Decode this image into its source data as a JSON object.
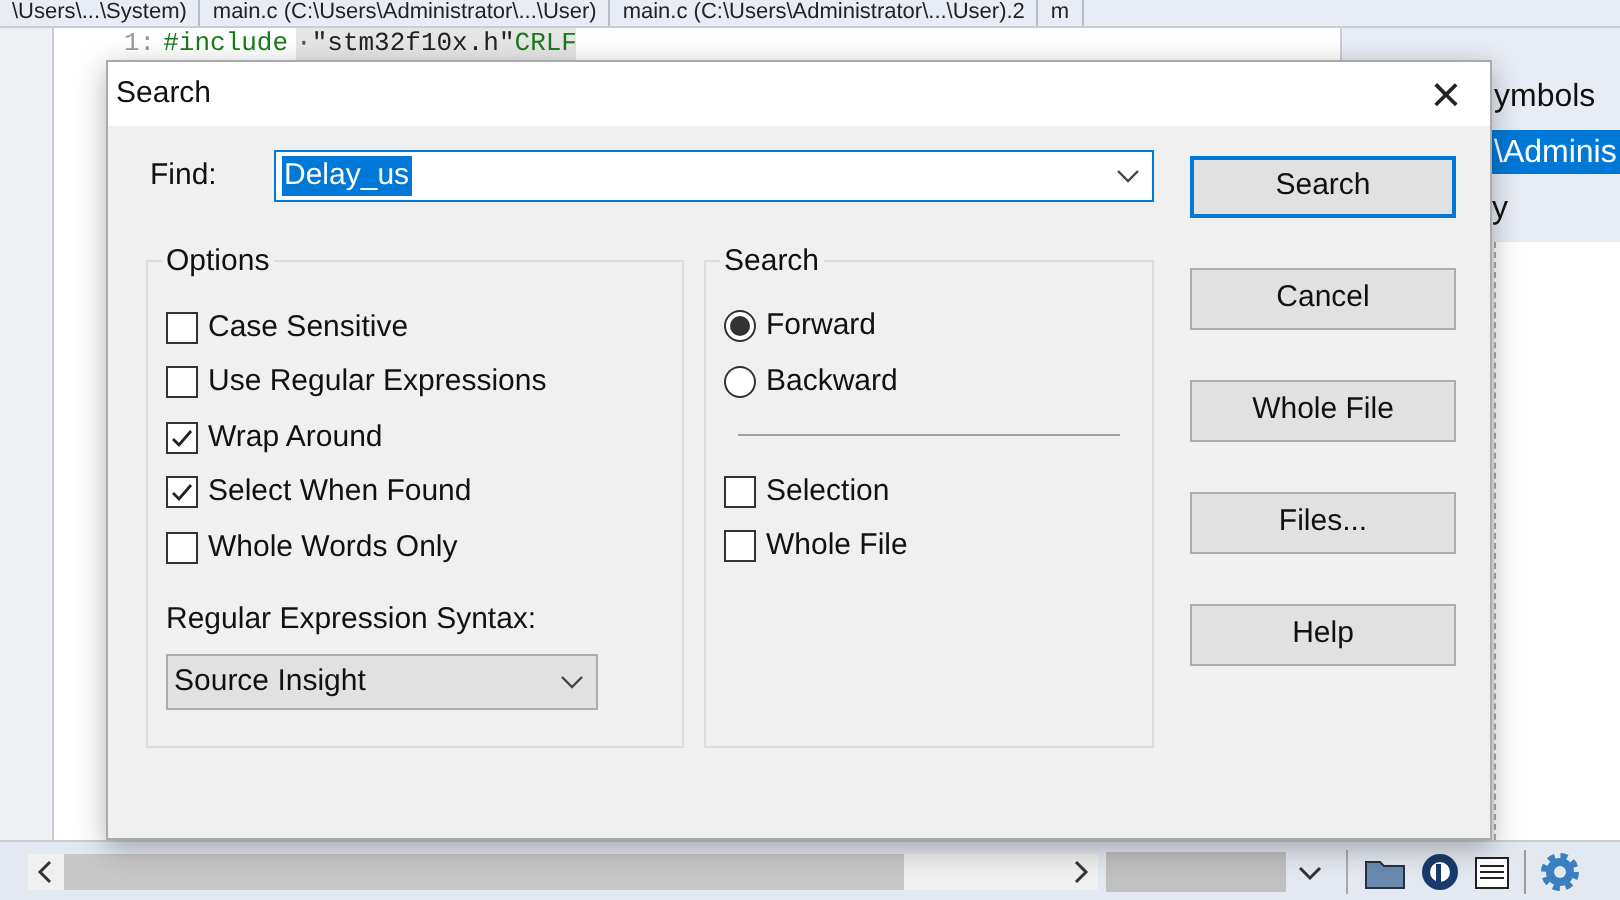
{
  "editor_tabs": [
    {
      "label": "\\Users\\...\\System)",
      "selected": false
    },
    {
      "label": "main.c (C:\\Users\\Administrator\\...\\User)",
      "selected": false
    },
    {
      "label": "main.c (C:\\Users\\Administrator\\...\\User).2",
      "selected": false
    },
    {
      "label": "m",
      "selected": false
    }
  ],
  "code_line": {
    "number": "1:",
    "keyword": "#include",
    "dot": "·",
    "string": "\"stm32f10x.h\"",
    "eol": "CRLF"
  },
  "side_panel": {
    "header": "ymbols",
    "path": "\\Adminis",
    "column": "y"
  },
  "dialog": {
    "title": "Search",
    "close": "×",
    "find": {
      "label": "Find:",
      "value": "Delay_us"
    },
    "options": {
      "title": "Options",
      "items": [
        {
          "label": "Case Sensitive",
          "checked": false
        },
        {
          "label": "Use Regular Expressions",
          "checked": false
        },
        {
          "label": "Wrap Around",
          "checked": true
        },
        {
          "label": "Select When Found",
          "checked": true
        },
        {
          "label": "Whole Words Only",
          "checked": false
        }
      ],
      "syntax_label": {
        "label": "Regular Expression Syntax:"
      },
      "syntax_value": "Source Insight"
    },
    "direction": {
      "title": "Search",
      "radios": [
        {
          "label": "Forward",
          "selected": true
        },
        {
          "label": "Backward",
          "selected": false
        }
      ],
      "items": [
        {
          "label": "Selection",
          "checked": false
        },
        {
          "label": "Whole File",
          "checked": false
        }
      ]
    },
    "buttons": [
      {
        "label": "Search",
        "default": true
      },
      {
        "label": "Cancel",
        "default": false
      },
      {
        "label": "Whole File",
        "default": false
      },
      {
        "label": "Files...",
        "default": false
      },
      {
        "label": "Help",
        "default": false
      }
    ]
  }
}
